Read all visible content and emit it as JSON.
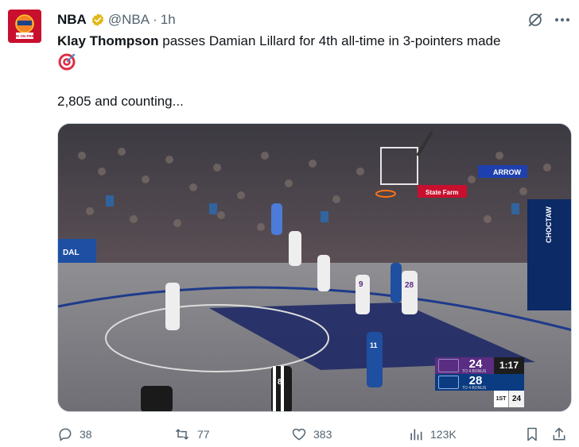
{
  "tweet": {
    "author": {
      "name": "NBA",
      "handle": "@NBA",
      "time_separator": "·",
      "timestamp": "1h",
      "avatar_caption": "LIVE ON PRIME",
      "verified": true
    },
    "text": {
      "player1": "Klay Thompson",
      "rest": " passes Damian Lillard for 4th all-time in 3-pointers made",
      "emoji": "direct-hit-icon",
      "line2": "2,805 and counting..."
    },
    "media": {
      "arena_sign_1": "ARROW",
      "arena_sign_2": "State Farm",
      "arena_sign_3": "CHOCTAW",
      "jersey_numbers": [
        "9",
        "28",
        "8",
        "11"
      ],
      "scoreboard": {
        "home_score": "24",
        "away_score": "28",
        "home_sub": "TO 4  BONUS",
        "away_sub": "TO 4  BONUS",
        "clock": "1:17",
        "period": "1ST",
        "shot_clock": "24"
      }
    },
    "actions": {
      "replies": "38",
      "reposts": "77",
      "likes": "383",
      "views": "123K"
    }
  },
  "colors": {
    "text_primary": "#0f1419",
    "text_secondary": "#536471",
    "verified_gold": "#e2b719",
    "media_border": "#cfd9de"
  }
}
